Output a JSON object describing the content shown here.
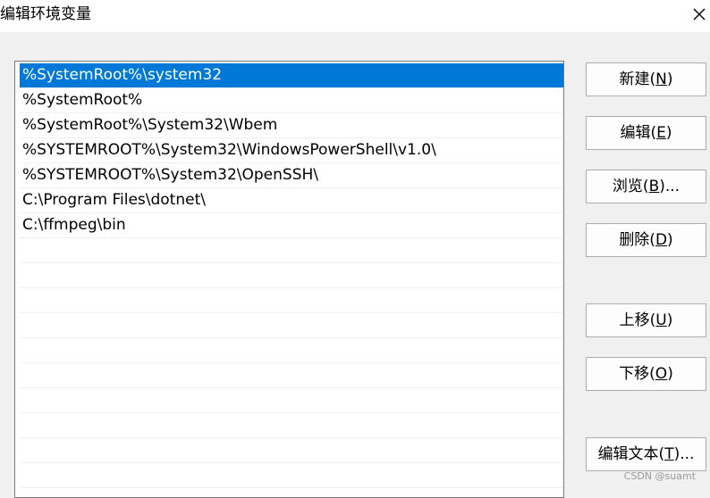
{
  "window": {
    "title": "编辑环境变量",
    "close_icon": "close-icon"
  },
  "path_list": {
    "items": [
      "%SystemRoot%\\system32",
      "%SystemRoot%",
      "%SystemRoot%\\System32\\Wbem",
      "%SYSTEMROOT%\\System32\\WindowsPowerShell\\v1.0\\",
      "%SYSTEMROOT%\\System32\\OpenSSH\\",
      "C:\\Program Files\\dotnet\\",
      "C:\\ffmpeg\\bin",
      "",
      "",
      "",
      "",
      "",
      "",
      "",
      "",
      "",
      ""
    ],
    "selected_index": 0
  },
  "buttons": {
    "new": {
      "text": "新建(",
      "key": "N",
      "suffix": ")"
    },
    "edit": {
      "text": "编辑(",
      "key": "E",
      "suffix": ")"
    },
    "browse": {
      "text": "浏览(",
      "key": "B",
      "suffix": ")..."
    },
    "delete": {
      "text": "删除(",
      "key": "D",
      "suffix": ")"
    },
    "move_up": {
      "text": "上移(",
      "key": "U",
      "suffix": ")"
    },
    "move_down": {
      "text": "下移(",
      "key": "O",
      "suffix": ")"
    },
    "edit_text": {
      "text": "编辑文本(",
      "key": "T",
      "suffix": ")..."
    }
  },
  "watermark": "CSDN @suamt",
  "colors": {
    "selection": "#0078d7",
    "window_bg": "#f0f0f0",
    "titlebar_bg": "#ffffff"
  }
}
